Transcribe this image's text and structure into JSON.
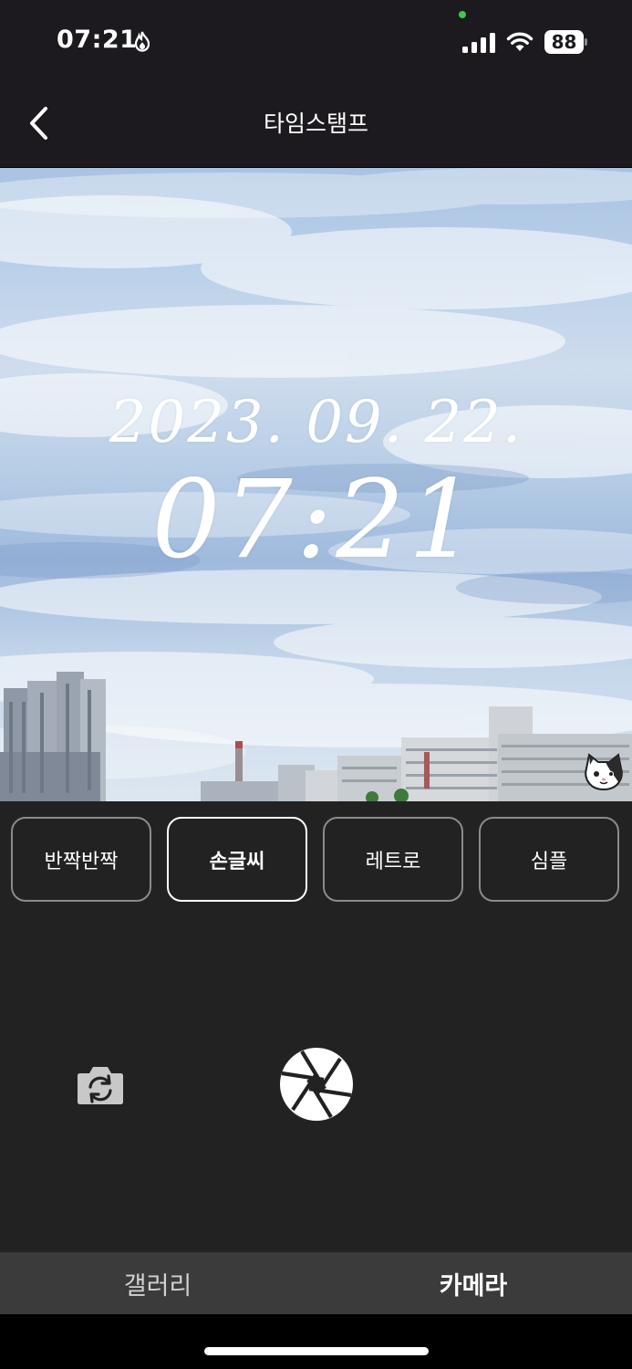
{
  "status_bar": {
    "time": "07:21",
    "battery": "88",
    "activity_icon": "flame-icon",
    "signal_icon": "cellular-signal-icon",
    "wifi_icon": "wifi-icon"
  },
  "nav": {
    "title": "타임스탬프",
    "back_icon": "chevron-left-icon"
  },
  "preview": {
    "stamp_date": "2023. 09. 22.",
    "stamp_time": "07:21",
    "sticker_icon": "cat-face-icon"
  },
  "styles": {
    "items": [
      {
        "label": "반짝반짝",
        "selected": false
      },
      {
        "label": "손글씨",
        "selected": true
      },
      {
        "label": "레트로",
        "selected": false
      },
      {
        "label": "심플",
        "selected": false
      }
    ]
  },
  "camera_controls": {
    "flip_icon": "camera-flip-icon",
    "shutter_icon": "aperture-shutter-icon"
  },
  "tabs": {
    "items": [
      {
        "label": "갤러리",
        "active": false
      },
      {
        "label": "카메라",
        "active": true
      }
    ]
  },
  "colors": {
    "background": "#1c1a1f",
    "controls_bg": "#222222",
    "tab_bar_bg": "#3b3b3b",
    "selected_border": "#ffffff",
    "unselected_border": "#8b8b8b",
    "status_dot": "#3ec64d"
  }
}
